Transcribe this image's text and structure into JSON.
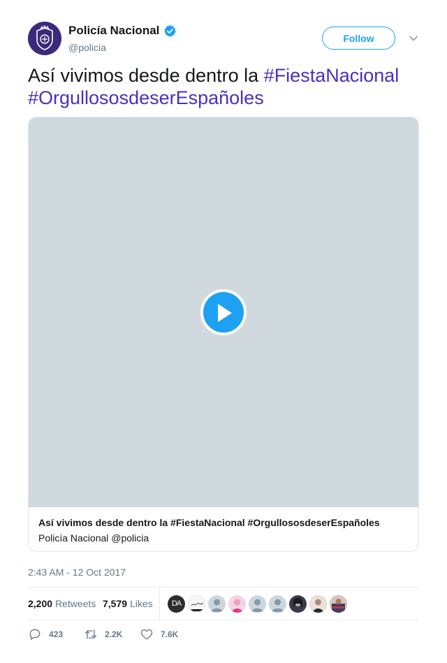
{
  "account": {
    "display_name": "Policía Nacional",
    "handle": "@policia",
    "verified": true,
    "follow_label": "Follow"
  },
  "tweet": {
    "text_plain": "Así vivimos desde dentro la ",
    "hashtag_1": "#FiestaNacional",
    "hashtag_2": "#OrgullososdeserEspañoles",
    "timestamp": "2:43 AM - 12 Oct 2017"
  },
  "media": {
    "card_title": "Así vivimos desde dentro la #FiestaNacional #OrgullososdeserEspañoles",
    "card_subtitle": "Policía Nacional @policia"
  },
  "stats": {
    "retweets_count": "2,200",
    "retweets_label": "Retweets",
    "likes_count": "7,579",
    "likes_label": "Likes",
    "liker_initials": "DA"
  },
  "actions": {
    "replies": "423",
    "retweets": "2.2K",
    "likes": "7.6K"
  },
  "colors": {
    "accent": "#1da1f2",
    "hashtag": "#4a2fc0",
    "muted": "#657786",
    "video_bg": "#cfd9de"
  }
}
